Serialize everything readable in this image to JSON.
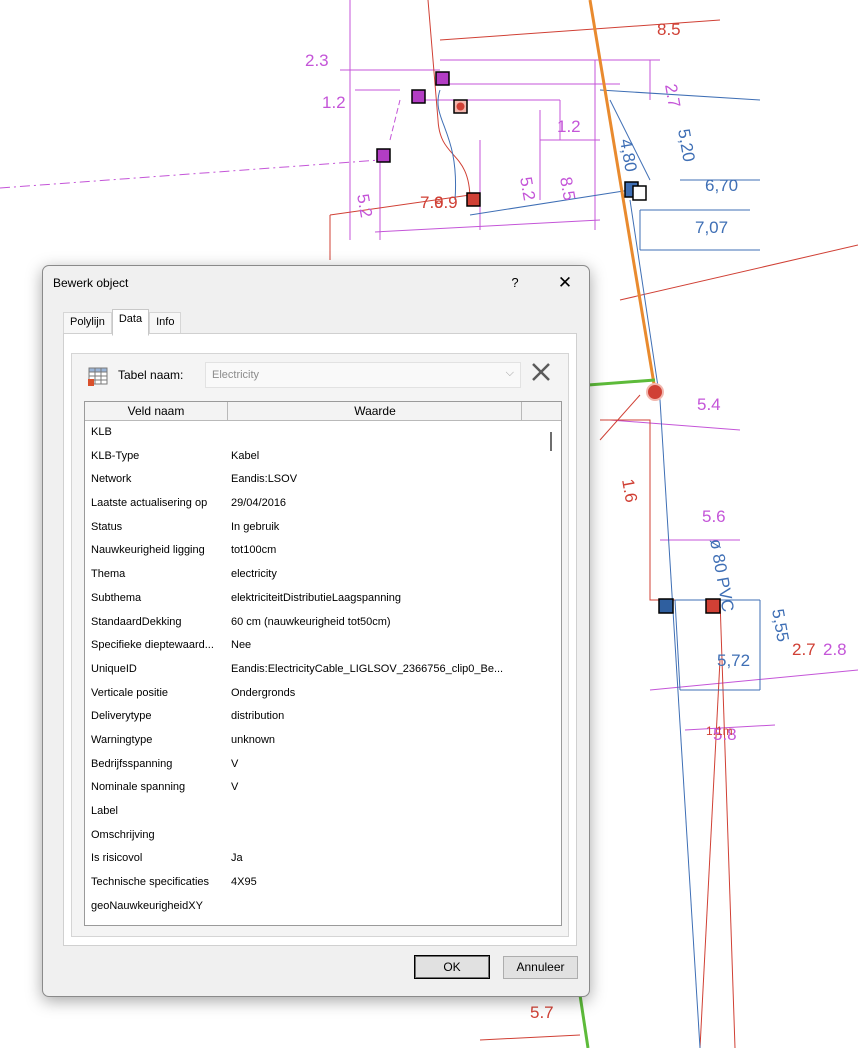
{
  "drawing": {
    "labels": [
      {
        "text": "8.5",
        "color": "#d04035"
      },
      {
        "text": "2.3",
        "color": "#c455d8"
      },
      {
        "text": "1.2",
        "color": "#c455d8"
      },
      {
        "text": "2.7",
        "color": "#c455d8"
      },
      {
        "text": "5,20",
        "color": "#3f6fb5"
      },
      {
        "text": "1.2",
        "color": "#c455d8"
      },
      {
        "text": "4,80",
        "color": "#3f6fb5"
      },
      {
        "text": "6,70",
        "color": "#3f6fb5"
      },
      {
        "text": "7,07",
        "color": "#3f6fb5"
      },
      {
        "text": "5.2",
        "color": "#c455d8"
      },
      {
        "text": "8.5",
        "color": "#c455d8"
      },
      {
        "text": "7.9",
        "color": "#d04035"
      },
      {
        "text": "6.9",
        "color": "#d04035"
      },
      {
        "text": "5.2",
        "color": "#c455d8"
      },
      {
        "text": "5.4",
        "color": "#c455d8"
      },
      {
        "text": "1.6",
        "color": "#d04035"
      },
      {
        "text": "5.6",
        "color": "#c455d8"
      },
      {
        "text": "ø 80 PVC",
        "color": "#3f6fb5"
      },
      {
        "text": "5,55",
        "color": "#3f6fb5"
      },
      {
        "text": "2.7",
        "color": "#d04035"
      },
      {
        "text": "2.8",
        "color": "#c455d8"
      },
      {
        "text": "5,72",
        "color": "#3f6fb5"
      },
      {
        "text": "5.8",
        "color": "#c455d8"
      },
      {
        "text": "1.1m",
        "color": "#d04035"
      },
      {
        "text": "5.7",
        "color": "#d04035"
      }
    ]
  },
  "dialog": {
    "title": "Bewerk object",
    "help": "?",
    "close": "✕",
    "tabs": [
      "Polylijn",
      "Data",
      "Info"
    ],
    "active_tab": "Data",
    "table_label": "Tabel naam:",
    "table_value": "Electricity",
    "dropdown_arrow": "⌵",
    "columns": [
      "Veld naam",
      "Waarde"
    ],
    "rows": [
      {
        "name": "KLB",
        "value": ""
      },
      {
        "name": "KLB-Type",
        "value": "Kabel"
      },
      {
        "name": "Network",
        "value": "Eandis:LSOV"
      },
      {
        "name": "Laatste actualisering op",
        "value": "29/04/2016"
      },
      {
        "name": "Status",
        "value": "In gebruik"
      },
      {
        "name": "Nauwkeurigheid ligging",
        "value": "tot100cm"
      },
      {
        "name": "Thema",
        "value": "electricity"
      },
      {
        "name": "Subthema",
        "value": "elektriciteitDistributieLaagspanning"
      },
      {
        "name": "StandaardDekking",
        "value": "60 cm (nauwkeurigheid tot50cm)"
      },
      {
        "name": "Specifieke dieptewaard...",
        "value": "Nee"
      },
      {
        "name": "UniqueID",
        "value": "Eandis:ElectricityCable_LIGLSOV_2366756_clip0_Be..."
      },
      {
        "name": "Verticale positie",
        "value": "Ondergronds"
      },
      {
        "name": "Deliverytype",
        "value": "distribution"
      },
      {
        "name": "Warningtype",
        "value": "unknown"
      },
      {
        "name": "Bedrijfsspanning",
        "value": " V"
      },
      {
        "name": "Nominale spanning",
        "value": " V"
      },
      {
        "name": "Label",
        "value": ""
      },
      {
        "name": "Omschrijving",
        "value": ""
      },
      {
        "name": "Is risicovol",
        "value": "Ja"
      },
      {
        "name": "Technische specificaties",
        "value": "4X95"
      },
      {
        "name": "geoNauwkeurigheidXY",
        "value": ""
      }
    ],
    "ok_label": "OK",
    "cancel_label": "Annuleer",
    "icons": {
      "table": "table-icon",
      "delete": "delete-x-icon"
    }
  }
}
